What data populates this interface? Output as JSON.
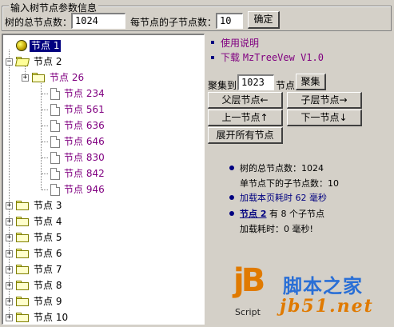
{
  "header": {
    "legend": "输入树节点参数信息",
    "total_label": "树的总节点数：",
    "total_value": "1024",
    "children_label": "每节点的子节点数：",
    "children_value": "10",
    "confirm_label": "确定"
  },
  "tree": {
    "root": "节点 1",
    "node2": "节点 2",
    "node26": "节点 26",
    "leaves": [
      "节点 234",
      "节点 561",
      "节点 636",
      "节点 646",
      "节点 830",
      "节点 842",
      "节点 946"
    ],
    "siblings": [
      "节点 3",
      "节点 4",
      "节点 5",
      "节点 6",
      "节点 7",
      "节点 8",
      "节点 9",
      "节点 10"
    ]
  },
  "links": {
    "help": "使用说明",
    "download_prefix": "下载 ",
    "download_name": "MzTreeVew V1.0"
  },
  "focus": {
    "label": "聚集到",
    "value": "1023",
    "suffix": "节点",
    "button": "聚集"
  },
  "nav": {
    "parent": "父层节点←",
    "child": "子层节点→",
    "prev": "上一节点↑",
    "next": "下一节点↓",
    "expand_all": "展开所有节点"
  },
  "stats": {
    "total": "树的总节点数：1024",
    "per_node": "单节点下的子节点数：10",
    "load_time": "加载本页耗时 62 毫秒",
    "selected_node": "节点 2",
    "selected_mid": " 有 8 个子节点",
    "load_cost": "加载耗时：0 毫秒!"
  },
  "logo": {
    "mark": "jB",
    "script": "Script",
    "cn": "脚本之家",
    "url": "jb51.net"
  },
  "colors": {
    "background": "#d4d0c8",
    "selection": "#000080",
    "link": "#800080",
    "logo_orange": "#e07a00"
  }
}
